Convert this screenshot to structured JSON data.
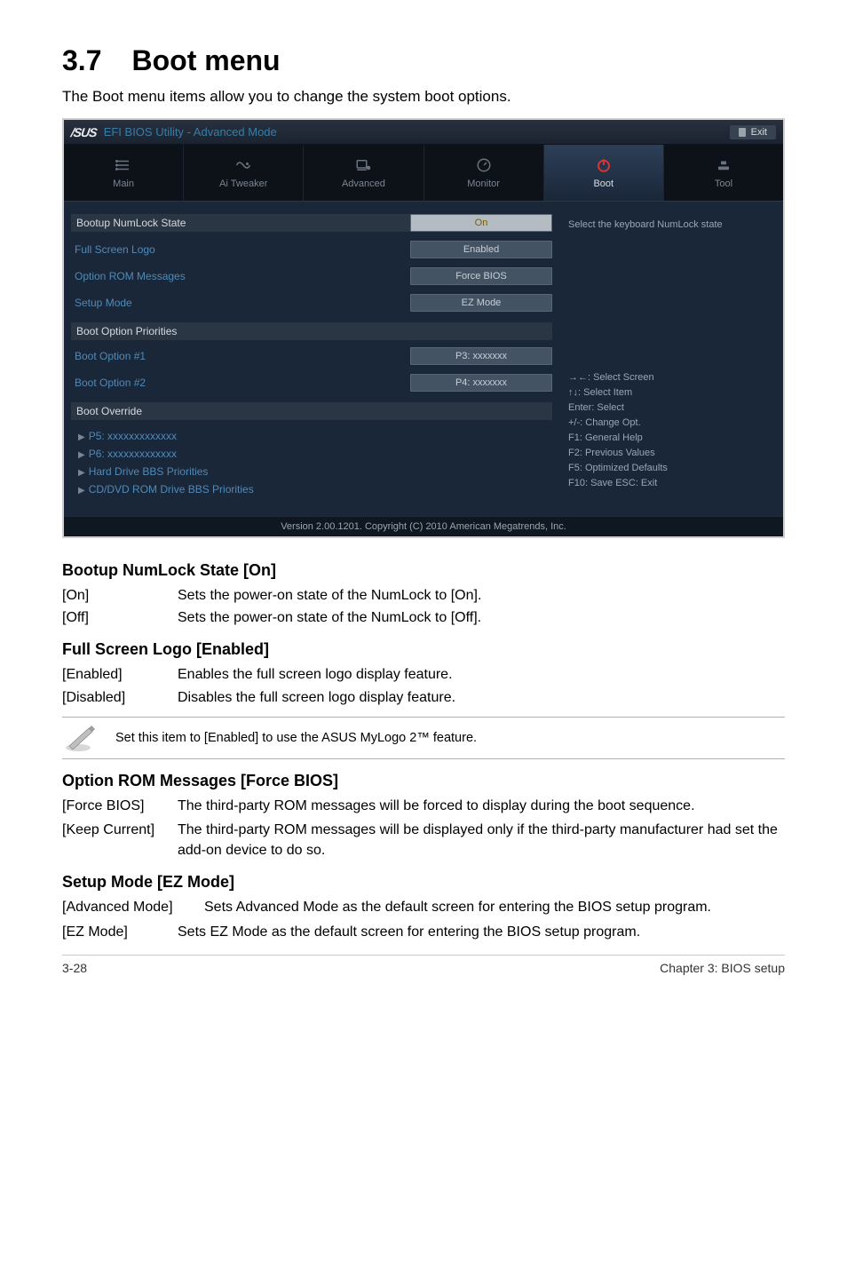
{
  "section": {
    "number": "3.7",
    "title": "Boot menu"
  },
  "intro": "The Boot menu items allow you to change the system boot options.",
  "bios": {
    "brand": "/SUS",
    "brand_rest": "EFI BIOS Utility - Advanced Mode",
    "exit": "Exit",
    "tabs": {
      "main": "Main",
      "ai": "Ai Tweaker",
      "advanced": "Advanced",
      "monitor": "Monitor",
      "boot": "Boot",
      "tool": "Tool"
    },
    "rows": {
      "numlock": {
        "label": "Bootup NumLock State",
        "value": "On"
      },
      "fslogo": {
        "label": "Full Screen Logo",
        "value": "Enabled"
      },
      "optrom": {
        "label": "Option ROM Messages",
        "value": "Force BIOS"
      },
      "setup": {
        "label": "Setup Mode",
        "value": "EZ Mode"
      }
    },
    "group_priorities": "Boot Option Priorities",
    "boot1": {
      "label": "Boot Option #1",
      "value": "P3: xxxxxxx"
    },
    "boot2": {
      "label": "Boot Option #2",
      "value": "P4: xxxxxxx"
    },
    "group_override": "Boot Override",
    "ov1": "P5: xxxxxxxxxxxxx",
    "ov2": "P6: xxxxxxxxxxxxx",
    "ov3": "Hard Drive BBS Priorities",
    "ov4": "CD/DVD ROM Drive BBS Priorities",
    "help_top": "Select the keyboard NumLock state",
    "hints": {
      "h1": "→←: Select Screen",
      "h2": "↑↓: Select Item",
      "h3": "Enter: Select",
      "h4": "+/-: Change Opt.",
      "h5": "F1: General Help",
      "h6": "F2: Previous Values",
      "h7": "F5: Optimized Defaults",
      "h8": "F10: Save   ESC: Exit"
    },
    "footer": "Version 2.00.1201.  Copyright (C) 2010 American Megatrends, Inc."
  },
  "doc": {
    "numlock_h": "Bootup NumLock State [On]",
    "numlock_on_k": "[On]",
    "numlock_on_d": "Sets the power-on state of the NumLock to [On].",
    "numlock_off_k": "[Off]",
    "numlock_off_d": "Sets the power-on state of the NumLock to [Off].",
    "fslogo_h": "Full Screen Logo [Enabled]",
    "fs_en_k": "[Enabled]",
    "fs_en_d": "Enables the full screen logo display feature.",
    "fs_di_k": "[Disabled]",
    "fs_di_d": "Disables the full screen logo display feature.",
    "note": "Set this item to [Enabled] to use the ASUS MyLogo 2™ feature.",
    "optrom_h": "Option ROM Messages [Force BIOS]",
    "optrom_fb_k": "[Force BIOS]",
    "optrom_fb_d": "The third-party ROM messages will be forced to display during the boot sequence.",
    "optrom_kc_k": "[Keep Current]",
    "optrom_kc_d": "The third-party ROM messages will be displayed only if the third-party manufacturer had set the add-on device to do so.",
    "setup_h": "Setup Mode [EZ Mode]",
    "setup_am_k": "[Advanced Mode]",
    "setup_am_d": "Sets Advanced Mode as the default screen for entering the BIOS setup program.",
    "setup_ez_k": "[EZ Mode]",
    "setup_ez_d": "Sets EZ Mode as the default screen for entering the BIOS setup program."
  },
  "footer": {
    "left": "3-28",
    "right": "Chapter 3: BIOS setup"
  }
}
